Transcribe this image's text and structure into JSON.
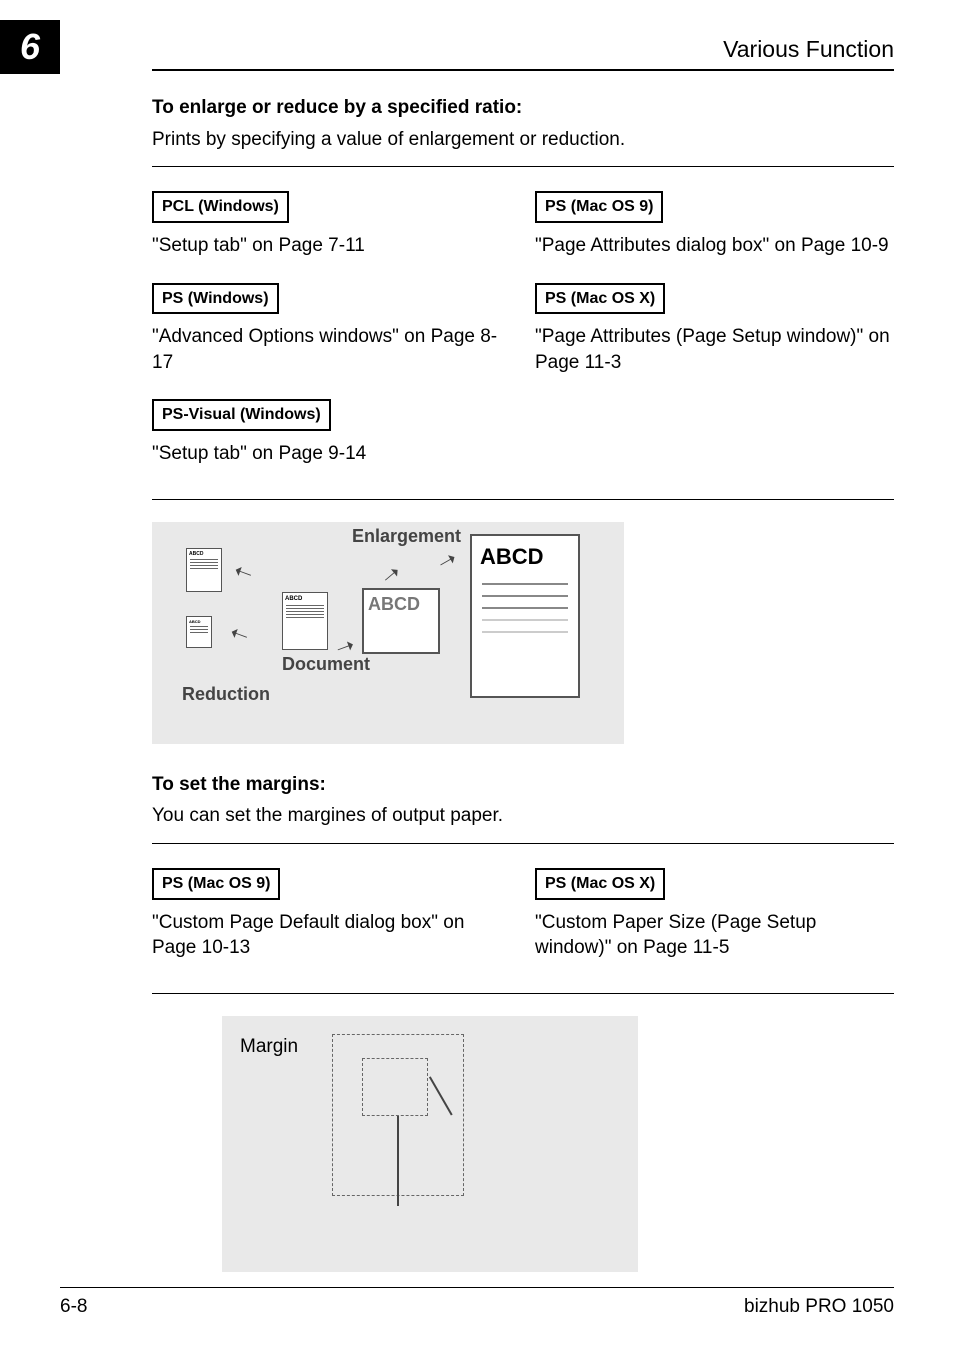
{
  "chapter_number": "6",
  "header_title": "Various Function",
  "section1": {
    "heading": "To enlarge or reduce by a specified ratio:",
    "desc": "Prints by specifying a value of enlargement or reduction.",
    "left": [
      {
        "tag": "PCL (Windows)",
        "ref": "\"Setup tab\" on Page 7-11"
      },
      {
        "tag": "PS (Windows)",
        "ref": "\"Advanced Options windows\" on Page 8-17"
      },
      {
        "tag": "PS-Visual (Windows)",
        "ref": "\"Setup tab\" on Page 9-14"
      }
    ],
    "right": [
      {
        "tag": "PS (Mac OS 9)",
        "ref": "\"Page Attributes dialog box\" on Page 10-9"
      },
      {
        "tag": "PS (Mac OS X)",
        "ref": "\"Page Attributes (Page Setup window)\" on Page 11-3"
      }
    ]
  },
  "figure1": {
    "enlargement": "Enlargement",
    "document": "Document",
    "reduction": "Reduction",
    "abcd_small": "ABCD",
    "abcd_large": "ABCD"
  },
  "section2": {
    "heading": "To set the margins:",
    "desc": "You can set the margines of output paper.",
    "left": [
      {
        "tag": "PS (Mac OS 9)",
        "ref": "\"Custom Page Default dialog box\" on Page 10-13"
      }
    ],
    "right": [
      {
        "tag": "PS (Mac OS X)",
        "ref": "\"Custom Paper Size (Page Setup window)\" on Page 11-5"
      }
    ]
  },
  "figure2": {
    "margin": "Margin"
  },
  "footer": {
    "page": "6-8",
    "product": "bizhub PRO 1050"
  }
}
